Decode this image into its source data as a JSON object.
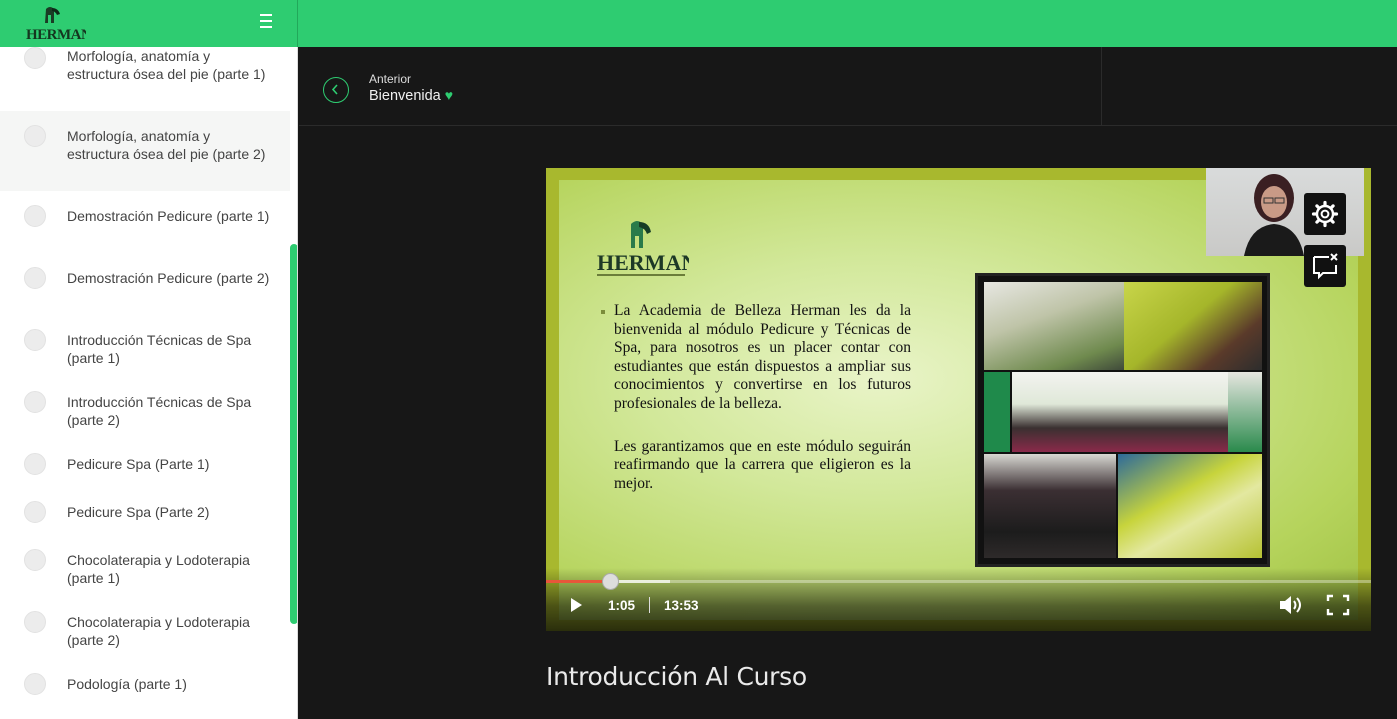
{
  "header": {
    "brand": "HERMAN",
    "menu_icon": "hamburger-icon"
  },
  "colors": {
    "accent": "#2ecc71",
    "content_bg": "#171717",
    "progress_played": "#e8573a"
  },
  "sidebar": {
    "items": [
      {
        "label": "Morfología, anatomía y estructura ósea del pie (parte 1)",
        "active": false
      },
      {
        "label": "Morfología, anatomía y estructura ósea del pie (parte 2)",
        "active": true
      },
      {
        "label": "Demostración Pedicure (parte 1)",
        "active": false
      },
      {
        "label": "Demostración Pedicure (parte 2)",
        "active": false
      },
      {
        "label": "Introducción Técnicas de Spa (parte 1)",
        "active": false
      },
      {
        "label": "Introducción Técnicas de Spa (parte 2)",
        "active": false
      },
      {
        "label": "Pedicure Spa (Parte 1)",
        "active": false
      },
      {
        "label": "Pedicure Spa (Parte 2)",
        "active": false
      },
      {
        "label": "Chocolaterapia y Lodoterapia (parte 1)",
        "active": false
      },
      {
        "label": "Chocolaterapia y Lodoterapia (parte 2)",
        "active": false
      },
      {
        "label": "Podología (parte 1)",
        "active": false
      }
    ]
  },
  "nav": {
    "previous_label": "Anterior",
    "previous_title": "Bienvenida",
    "previous_icon": "chevron-left-icon"
  },
  "video": {
    "slide_brand": "HERMAN",
    "slide_paragraphs": [
      "La Academia de Belleza Herman les da la bienvenida al módulo Pedicure y Técnicas de Spa, para nosotros es un placer contar con estudiantes que están dispuestos a ampliar sus conocimientos y convertirse en los futuros profesionales de la belleza.",
      "Les garantizamos que en este módulo seguirán reafirmando que la carrera que eligieron es la mejor."
    ],
    "current_time": "1:05",
    "duration": "13:53",
    "played_fraction": 0.078,
    "buffered_fraction": 0.15,
    "icons": [
      "gear-icon",
      "caption-off-icon",
      "play-icon",
      "volume-icon",
      "fullscreen-icon"
    ]
  },
  "lesson": {
    "title": "Introducción Al Curso"
  }
}
